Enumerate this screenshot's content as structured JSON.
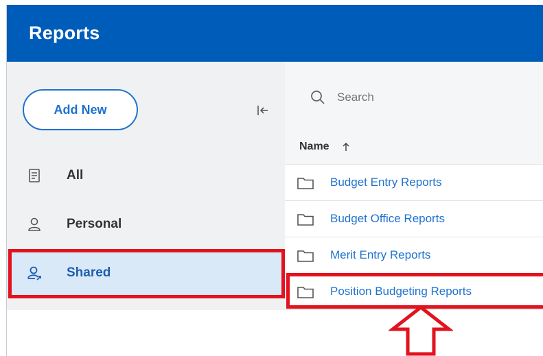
{
  "header": {
    "title": "Reports"
  },
  "sidebar": {
    "add_new_label": "Add New",
    "items": [
      {
        "label": "All",
        "icon": "document-icon"
      },
      {
        "label": "Personal",
        "icon": "person-icon"
      },
      {
        "label": "Shared",
        "icon": "shared-person-icon",
        "selected": true
      }
    ]
  },
  "search": {
    "placeholder": "Search"
  },
  "table": {
    "column": "Name",
    "sort": "ascending",
    "rows": [
      {
        "label": "Budget Entry Reports",
        "icon": "folder-icon"
      },
      {
        "label": "Budget Office Reports",
        "icon": "folder-icon"
      },
      {
        "label": "Merit Entry Reports",
        "icon": "folder-icon"
      },
      {
        "label": "Position Budgeting Reports",
        "icon": "folder-icon"
      }
    ]
  },
  "colors": {
    "brand": "#005cb9",
    "link": "#1f72cf",
    "selected_bg": "#d9e9f8",
    "annotation": "#e2131e"
  }
}
